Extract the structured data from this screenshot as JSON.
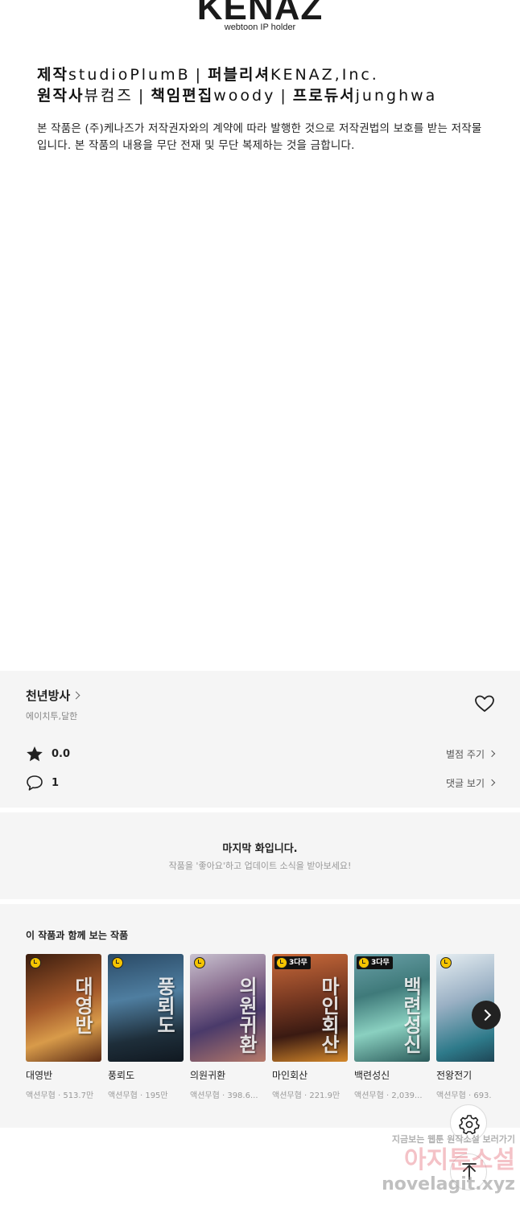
{
  "credits": {
    "logo": "KENAZ",
    "logo_tagline": "webtoon IP holder",
    "line1": {
      "k1": "제작",
      "v1": "studioPlumB",
      "sep": "|",
      "k2": "퍼블리셔",
      "v2": "KENAZ,Inc."
    },
    "line2": {
      "k1": "원작사",
      "v1": "뷰컴즈",
      "sep": "|",
      "k2": "책임편집",
      "v2": "woody",
      "k3": "프로듀서",
      "v3": "junghwa"
    },
    "notice": "본 작품은 (주)케나즈가 저작권자와의 계약에 따라 발행한 것으로 저작권법의 보호를 받는 저작물입니다. 본 작품의 내용을 무단 전재 및 무단 복제하는 것을 금합니다."
  },
  "series": {
    "title": "천년방사",
    "authors": "에이치투,달한",
    "rating": "0.0",
    "rate_action": "별점 주기",
    "comments": "1",
    "comments_action": "댓글 보기"
  },
  "last_episode": {
    "title": "마지막 화입니다.",
    "subtitle": "작품을 '좋아요'하고 업데이트 소식을 받아보세요!"
  },
  "recommendations": {
    "heading": "이 작품과 함께 보는 작품",
    "items": [
      {
        "title": "대영반",
        "meta": "액션무협 · 513.7만",
        "badge": "",
        "art": "대영반"
      },
      {
        "title": "풍뢰도",
        "meta": "액션무협 · 195만",
        "badge": "",
        "art": "풍뢰도"
      },
      {
        "title": "의원귀환",
        "meta": "액션무협 · 398.6...",
        "badge": "",
        "art": "의원귀환"
      },
      {
        "title": "마인회산",
        "meta": "액션무협 · 221.9만",
        "badge": "3다무",
        "art": "마인회산"
      },
      {
        "title": "백련성신",
        "meta": "액션무협 · 2,039...",
        "badge": "3다무",
        "art": "백련성신"
      },
      {
        "title": "전왕전기",
        "meta": "액션무협 · 693.",
        "badge": "",
        "art": ""
      }
    ]
  },
  "watermark": {
    "line1": "지금보는 웹툰 원작소설 보러가기",
    "line2": "아지툰소설",
    "line3": "novelagit.xyz"
  },
  "colors": {
    "panel_bg": "#f5f5f5",
    "thumb_1": "#8a4a22",
    "thumb_2": "#3b5f7a",
    "thumb_3": "#6f5a78",
    "thumb_4": "#7a3a22",
    "thumb_5": "#5f9a8a",
    "thumb_6": "#9ab0c4"
  },
  "icons": {
    "heart": "heart-outline-icon",
    "star": "star-filled-icon",
    "comment": "speech-bubble-icon",
    "settings": "gear-icon",
    "top": "arrow-up-icon",
    "next": "chevron-right-icon"
  }
}
